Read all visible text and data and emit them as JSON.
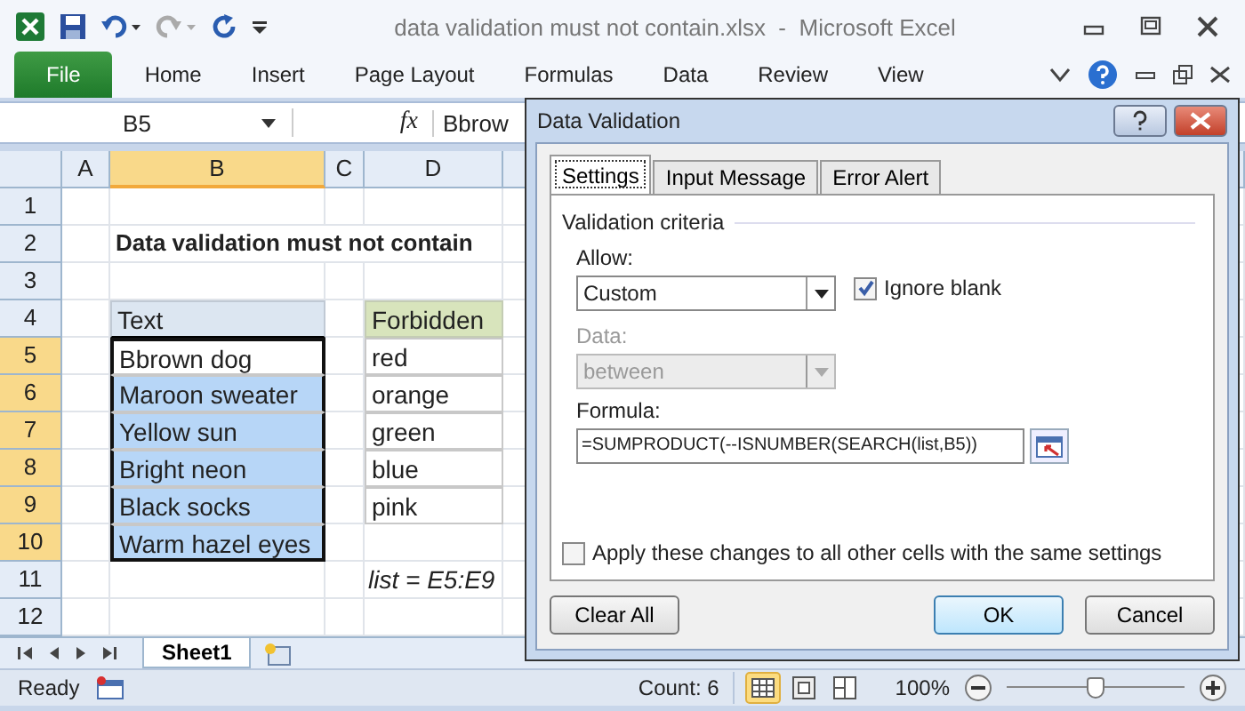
{
  "window": {
    "title": "data validation must not contain.xlsx  -  Microsoft Excel"
  },
  "ribbon_tabs": [
    {
      "label": "File",
      "kind": "backstage"
    },
    {
      "label": "Home",
      "kind": "tab"
    },
    {
      "label": "Insert",
      "kind": "tab"
    },
    {
      "label": "Page Layout",
      "kind": "tab"
    },
    {
      "label": "Formulas",
      "kind": "tab"
    },
    {
      "label": "Data",
      "kind": "tab"
    },
    {
      "label": "Review",
      "kind": "tab"
    },
    {
      "label": "View",
      "kind": "tab"
    }
  ],
  "formula_bar": {
    "name_box": "B5",
    "function_label": "fx",
    "formula": "Bbrow"
  },
  "columns": [
    {
      "label": "A",
      "selected": false
    },
    {
      "label": "B",
      "selected": true
    },
    {
      "label": "C",
      "selected": false
    },
    {
      "label": "D",
      "selected": false
    }
  ],
  "rows": [
    {
      "label": "1",
      "selected": false,
      "cells": {}
    },
    {
      "label": "2",
      "selected": false,
      "cells": {
        "B": {
          "text": "Data validation must not contain",
          "kind": "title"
        }
      }
    },
    {
      "label": "3",
      "selected": false,
      "cells": {}
    },
    {
      "label": "4",
      "selected": false,
      "cells": {
        "B": {
          "text": "Text",
          "kind": "header-blue"
        },
        "D": {
          "text": "Forbidden",
          "kind": "header-green"
        }
      }
    },
    {
      "label": "5",
      "selected": true,
      "cells": {
        "B": {
          "text": "Bbrown dog",
          "kind": "data",
          "selected": true,
          "active": true
        },
        "D": {
          "text": "red",
          "kind": "data"
        }
      }
    },
    {
      "label": "6",
      "selected": true,
      "cells": {
        "B": {
          "text": "Maroon sweater",
          "kind": "data",
          "selected": true,
          "active": false
        },
        "D": {
          "text": "orange",
          "kind": "data"
        }
      }
    },
    {
      "label": "7",
      "selected": true,
      "cells": {
        "B": {
          "text": "Yellow sun",
          "kind": "data",
          "selected": true,
          "active": false
        },
        "D": {
          "text": "green",
          "kind": "data"
        }
      }
    },
    {
      "label": "8",
      "selected": true,
      "cells": {
        "B": {
          "text": "Bright neon",
          "kind": "data",
          "selected": true,
          "active": false
        },
        "D": {
          "text": "blue",
          "kind": "data"
        }
      }
    },
    {
      "label": "9",
      "selected": true,
      "cells": {
        "B": {
          "text": "Black socks",
          "kind": "data",
          "selected": true,
          "active": false
        },
        "D": {
          "text": "pink",
          "kind": "data"
        }
      }
    },
    {
      "label": "10",
      "selected": true,
      "cells": {
        "B": {
          "text": "Warm hazel eyes",
          "kind": "data",
          "selected": true,
          "active": false
        }
      }
    },
    {
      "label": "11",
      "selected": false,
      "cells": {
        "D": {
          "text": "list = E5:E9",
          "kind": "note"
        }
      }
    },
    {
      "label": "12",
      "selected": false,
      "cells": {}
    }
  ],
  "sheet_tabs": [
    {
      "label": "Sheet1",
      "selected": true
    }
  ],
  "status_bar": {
    "mode": "Ready",
    "count": "Count: 6",
    "views": [
      {
        "kind": "normal",
        "selected": true
      },
      {
        "kind": "page-layout",
        "selected": false
      },
      {
        "kind": "page-break",
        "selected": false
      }
    ],
    "zoom": "100%",
    "zoom_slider": {
      "level": 0.5
    }
  },
  "dialog": {
    "title": "Data Validation",
    "tabs": [
      {
        "label": "Settings",
        "selected": true
      },
      {
        "label": "Input Message",
        "selected": false
      },
      {
        "label": "Error Alert",
        "selected": false
      }
    ],
    "group_title": "Validation criteria",
    "allow_label": "Allow:",
    "allow_value": "Custom",
    "ignore_blank": {
      "label": "Ignore blank",
      "checked": true
    },
    "data_label": "Data:",
    "data_value": "between",
    "data_disabled": true,
    "formula_label": "Formula:",
    "formula_value": "=SUMPRODUCT(--ISNUMBER(SEARCH(list,B5))",
    "apply_all": {
      "label": "Apply these changes to all other cells with the same settings",
      "checked": false
    },
    "buttons": [
      {
        "label": "Clear All",
        "kind": "secondary"
      },
      {
        "label": "OK",
        "kind": "default"
      },
      {
        "label": "Cancel",
        "kind": "secondary"
      }
    ]
  }
}
